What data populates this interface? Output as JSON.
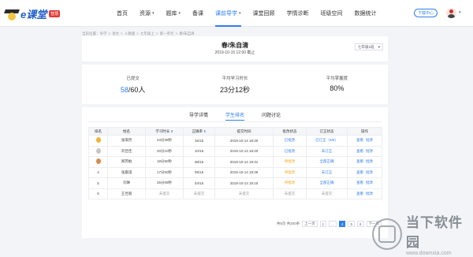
{
  "brand": {
    "logo_text": "e课堂",
    "badge": "智慧"
  },
  "nav": {
    "items": [
      {
        "label": "首页",
        "caret": ""
      },
      {
        "label": "资源",
        "caret": "▾"
      },
      {
        "label": "题库",
        "caret": "▾"
      },
      {
        "label": "备课",
        "caret": ""
      },
      {
        "label": "课前导学",
        "caret": "▾"
      },
      {
        "label": "课堂回顾",
        "caret": ""
      },
      {
        "label": "学情诊断",
        "caret": ""
      },
      {
        "label": "班级空间",
        "caret": ""
      },
      {
        "label": "数据统计",
        "caret": ""
      }
    ],
    "download_label": "下载中心"
  },
  "breadcrumb": [
    "当前位置：导学",
    ">",
    "语文",
    ">",
    "人教版",
    ">",
    "七年级上",
    ">",
    "第一单元",
    ">",
    "春/朱自清"
  ],
  "header": {
    "title": "春/朱自清",
    "time": "2019-10-15  12:00  截止",
    "class_select": "七年级1班",
    "class_caret": "▾"
  },
  "stats": {
    "submitted_label": "已提交",
    "submitted_count": "58",
    "submitted_total": "/60人",
    "avg_time_label": "平均学习时长",
    "avg_time_value": "23分12秒",
    "mastery_label": "平均掌握度",
    "mastery_value": "80%"
  },
  "tabs": [
    "导学详情",
    "学生排名",
    "问题讨论"
  ],
  "active_tab": 1,
  "table": {
    "columns": [
      "排名",
      "姓名",
      "学习时长",
      "正确率",
      "提交时间",
      "批改状态",
      "订正状态",
      "操作"
    ],
    "rows": [
      {
        "rank": "1",
        "medal": "gold",
        "name": "张琪然",
        "duration": "23分39秒",
        "accuracy": "15/15",
        "submit": "2019-10-14   18:30",
        "grade": "已批改",
        "grade_color": "blue",
        "fix": "已订正（5/5）",
        "fix_color": "blue",
        "ops": [
          "查看",
          "批改"
        ]
      },
      {
        "rank": "2",
        "medal": "silver",
        "name": "刘佳佳",
        "duration": "20分10秒",
        "accuracy": "10/15",
        "submit": "2019-10-14   18:20",
        "grade": "已批改",
        "grade_color": "blue",
        "fix": "未订正",
        "fix_color": "blue",
        "ops": [
          "查看",
          "批改"
        ]
      },
      {
        "rank": "3",
        "medal": "bronze",
        "name": "郑苏柏",
        "duration": "18分50秒",
        "accuracy": "08/15",
        "submit": "2019-10-14   19:31",
        "grade": "待批改",
        "grade_color": "orange",
        "fix": "全部正确",
        "fix_color": "blue",
        "ops": [
          "查看",
          "批改"
        ]
      },
      {
        "rank": "4",
        "medal": "",
        "name": "张嘉琪",
        "duration": "17分50秒",
        "accuracy": "09/15",
        "submit": "2019-10-14   18:36",
        "grade": "待批改",
        "grade_color": "orange",
        "fix": "未订正",
        "fix_color": "blue",
        "ops": [
          "查看",
          "批改"
        ]
      },
      {
        "rank": "5",
        "medal": "",
        "name": "刘琳",
        "duration": "25分09秒",
        "accuracy": "04/15",
        "submit": "2019-10-14   18:15",
        "grade": "待批改",
        "grade_color": "orange",
        "fix": "全部正确",
        "fix_color": "blue",
        "ops": [
          "查看",
          "批改"
        ]
      },
      {
        "rank": "6",
        "medal": "",
        "name": "王佳丽",
        "duration": "未提交",
        "accuracy": "未提交",
        "submit": "未提交",
        "grade": "未提交",
        "grade_color": "gray",
        "fix": "未提交",
        "fix_color": "gray",
        "ops": [
          "查看",
          "批改"
        ]
      }
    ]
  },
  "pagination": {
    "summary": "共5页  共200条",
    "prev": "上一页",
    "pages": [
      "1",
      "...",
      "4",
      "5",
      "6"
    ],
    "current": "4",
    "next": "下一页"
  },
  "watermark": {
    "cn": "当下软件园",
    "url": "www.downxia.com"
  }
}
